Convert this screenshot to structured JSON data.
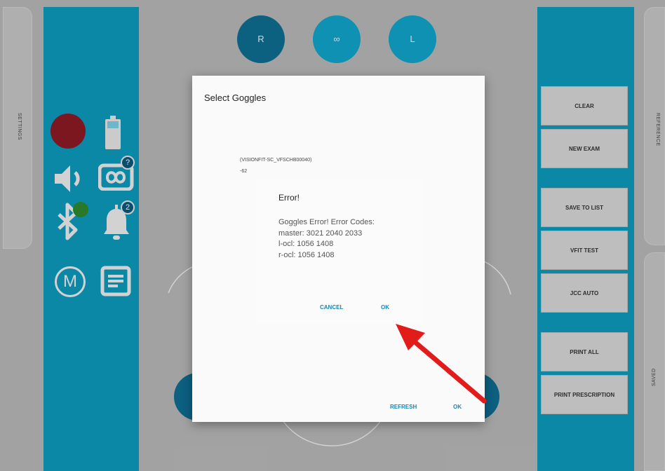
{
  "side_tabs": {
    "settings": "SETTINGS",
    "reference": "REFERENCE",
    "saved": "SAVED"
  },
  "eye_selector": {
    "right": "R",
    "both": "∞",
    "left": "L"
  },
  "left_icons": {
    "record_color": "#8e1b24",
    "goggles_badge": "?",
    "alerts_badge": "2",
    "mode_label": "M",
    "bluetooth_status_color": "#2e8b2e"
  },
  "right_panel": {
    "buttons": [
      "CLEAR",
      "NEW EXAM",
      "SAVE TO LIST",
      "VFIT TEST",
      "JCC AUTO",
      "PRINT ALL",
      "PRINT PRESCRIPTION"
    ]
  },
  "select_dialog": {
    "title": "Select Goggles",
    "device_name": "(VISIONFIT-SC_VFSCHB00040)",
    "device_signal": "-62",
    "refresh_label": "REFRESH",
    "ok_label": "OK"
  },
  "error_dialog": {
    "title": "Error!",
    "message_lines": [
      "Goggles  Error! Error Codes:",
      "master: 3021 2040 2033",
      "l-ocl: 1056 1408",
      "r-ocl: 1056 1408"
    ],
    "cancel_label": "CANCEL",
    "ok_label": "OK"
  },
  "colors": {
    "panel": "#0e9bbf",
    "accent": "#1a86b6",
    "arrow": "#e21b1b"
  }
}
